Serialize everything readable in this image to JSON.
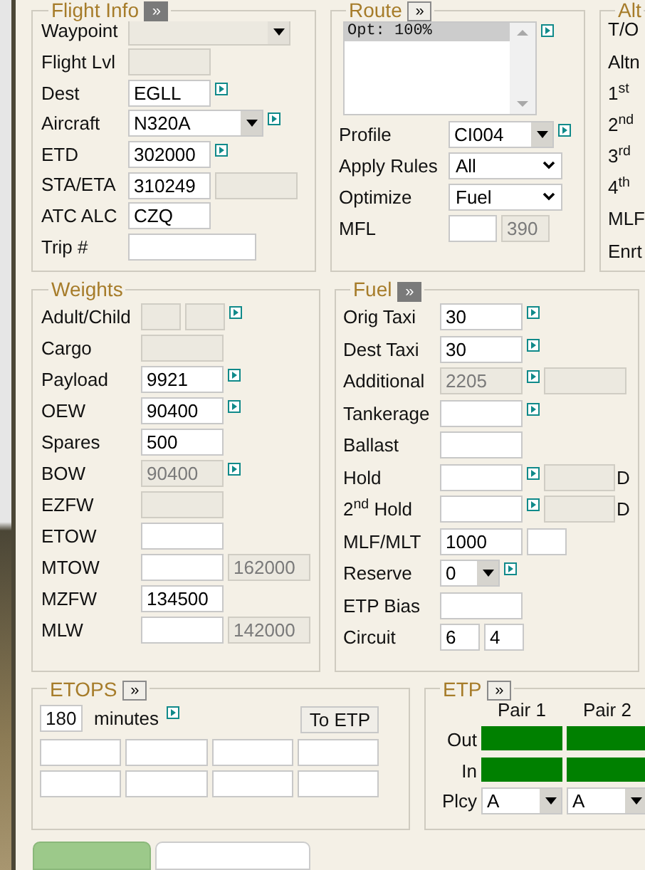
{
  "flight_info": {
    "title": "Flight Info",
    "expand": {
      "label": "»",
      "active": true
    },
    "rows": [
      {
        "label": "Waypoint",
        "controls": [
          {
            "kind": "dropdown-wide",
            "disabled": true
          }
        ]
      },
      {
        "label": "Flight Lvl",
        "controls": [
          {
            "kind": "input",
            "disabled": true
          }
        ]
      },
      {
        "label": "Dest",
        "controls": [
          {
            "kind": "input",
            "value": "EGLL",
            "disabled": false
          },
          {
            "kind": "link"
          }
        ]
      },
      {
        "label": "Aircraft",
        "controls": [
          {
            "kind": "dropdown",
            "value": "N320A",
            "disabled": false
          },
          {
            "kind": "link"
          }
        ]
      },
      {
        "label": "ETD",
        "controls": [
          {
            "kind": "input",
            "value": "302000",
            "disabled": false
          },
          {
            "kind": "link"
          }
        ]
      },
      {
        "label": "STA/ETA",
        "controls": [
          {
            "kind": "input",
            "value": "310249",
            "disabled": false
          },
          {
            "kind": "input",
            "disabled": true
          }
        ]
      },
      {
        "label": "ATC ALC",
        "controls": [
          {
            "kind": "input",
            "value": "CZQ",
            "disabled": false
          }
        ]
      },
      {
        "label": "Trip #",
        "controls": [
          {
            "kind": "input-wide",
            "disabled": false
          }
        ]
      }
    ]
  },
  "route": {
    "title": "Route",
    "expand": {
      "label": "»",
      "active": false
    },
    "lines": [
      {
        "text": "Opt: 100%",
        "selected": true
      }
    ],
    "rows": [
      {
        "label": "Profile",
        "controls": [
          {
            "kind": "dropdown-medium",
            "value": "CI004",
            "disabled": false
          },
          {
            "kind": "link"
          }
        ]
      },
      {
        "label": "Apply Rules",
        "controls": [
          {
            "kind": "select",
            "value": "All",
            "disabled": false
          }
        ]
      },
      {
        "label": "Optimize",
        "controls": [
          {
            "kind": "select",
            "value": "Fuel",
            "disabled": false
          }
        ]
      },
      {
        "label": "MFL",
        "controls": [
          {
            "kind": "input-short",
            "disabled": false
          },
          {
            "kind": "input-short",
            "value": "390",
            "disabled": true
          }
        ]
      }
    ]
  },
  "alternates": {
    "title": "Alt",
    "labels": [
      "T/O",
      "Altn",
      "1$^{st}$",
      "2$^{nd}$",
      "3$^{rd}$",
      "4$^{th}$",
      "MLF",
      "Enrt"
    ]
  },
  "weights": {
    "title": "Weights",
    "rows": [
      {
        "label": "Adult/Child",
        "controls": [
          {
            "kind": "input-narrow",
            "disabled": true
          },
          {
            "kind": "input-narrow",
            "disabled": true
          },
          {
            "kind": "link"
          }
        ]
      },
      {
        "label": "Cargo",
        "controls": [
          {
            "kind": "input",
            "disabled": true
          }
        ]
      },
      {
        "label": "Payload",
        "controls": [
          {
            "kind": "input",
            "value": "9921",
            "disabled": false
          },
          {
            "kind": "link"
          }
        ]
      },
      {
        "label": "OEW",
        "controls": [
          {
            "kind": "input",
            "value": "90400",
            "disabled": false
          },
          {
            "kind": "link"
          }
        ]
      },
      {
        "label": "Spares",
        "controls": [
          {
            "kind": "input",
            "value": "500",
            "disabled": false
          }
        ]
      },
      {
        "label": "BOW",
        "controls": [
          {
            "kind": "input",
            "value": "90400",
            "disabled": true
          },
          {
            "kind": "link"
          }
        ]
      },
      {
        "label": "EZFW",
        "controls": [
          {
            "kind": "input",
            "disabled": true
          }
        ]
      },
      {
        "label": "ETOW",
        "controls": [
          {
            "kind": "input",
            "disabled": false
          }
        ]
      },
      {
        "label": "MTOW",
        "controls": [
          {
            "kind": "input",
            "disabled": false
          },
          {
            "kind": "input",
            "value": "162000",
            "disabled": true
          }
        ]
      },
      {
        "label": "MZFW",
        "controls": [
          {
            "kind": "input",
            "value": "134500",
            "disabled": false
          }
        ]
      },
      {
        "label": "MLW",
        "controls": [
          {
            "kind": "input",
            "disabled": false
          },
          {
            "kind": "input",
            "value": "142000",
            "disabled": true
          }
        ]
      }
    ]
  },
  "fuel": {
    "title": "Fuel",
    "expand": {
      "label": "»",
      "active": true
    },
    "rows": [
      {
        "label": "Orig Taxi",
        "controls": [
          {
            "kind": "input",
            "value": "30",
            "disabled": false
          },
          {
            "kind": "link"
          }
        ]
      },
      {
        "label": "Dest Taxi",
        "controls": [
          {
            "kind": "input",
            "value": "30",
            "disabled": false
          },
          {
            "kind": "link"
          }
        ]
      },
      {
        "label": "Additional",
        "controls": [
          {
            "kind": "input",
            "value": "2205",
            "disabled": true
          },
          {
            "kind": "link"
          },
          {
            "kind": "input",
            "disabled": true
          }
        ]
      },
      {
        "label": "Tankerage",
        "controls": [
          {
            "kind": "input",
            "disabled": false
          },
          {
            "kind": "link"
          }
        ]
      },
      {
        "label": "Ballast",
        "controls": [
          {
            "kind": "input",
            "disabled": false
          }
        ]
      },
      {
        "label": "Hold",
        "controls": [
          {
            "kind": "input",
            "disabled": false
          },
          {
            "kind": "link"
          },
          {
            "kind": "input-medium",
            "disabled": true
          },
          {
            "kind": "suffix",
            "text": "D"
          }
        ]
      },
      {
        "label": "2$^{nd}$ Hold",
        "controls": [
          {
            "kind": "input",
            "disabled": false
          },
          {
            "kind": "link"
          },
          {
            "kind": "input-medium",
            "disabled": true
          },
          {
            "kind": "suffix",
            "text": "D"
          }
        ]
      },
      {
        "label": "MLF/MLT",
        "controls": [
          {
            "kind": "input",
            "value": "1000",
            "disabled": false
          },
          {
            "kind": "input-narrow",
            "disabled": false
          }
        ]
      },
      {
        "label": "Reserve",
        "controls": [
          {
            "kind": "dropdown-narrow",
            "value": "0",
            "disabled": false
          },
          {
            "kind": "link"
          }
        ]
      },
      {
        "label": "ETP Bias",
        "controls": [
          {
            "kind": "input",
            "disabled": false
          }
        ]
      },
      {
        "label": "Circuit",
        "controls": [
          {
            "kind": "input-narrow",
            "value": "6",
            "disabled": false
          },
          {
            "kind": "input-narrow",
            "value": "4",
            "disabled": false
          }
        ]
      }
    ]
  },
  "etops": {
    "title": "ETOPS",
    "expand": {
      "label": "»",
      "active": false
    },
    "minutes": {
      "value": "180",
      "label": "minutes"
    },
    "button": "To ETP",
    "result_fields": [
      {
        "disabled": false
      },
      {
        "disabled": false
      },
      {
        "disabled": false
      },
      {
        "disabled": false
      },
      {
        "disabled": false
      },
      {
        "disabled": false
      },
      {
        "disabled": false
      },
      {
        "disabled": false
      }
    ]
  },
  "etp": {
    "title": "ETP",
    "expand": {
      "label": "»",
      "active": false
    },
    "columns": [
      "Pair 1",
      "Pair 2"
    ],
    "rows": [
      {
        "label": "Out",
        "kind": "status",
        "cells": [
          {
            "color": "#008000"
          },
          {
            "color": "#008000"
          }
        ]
      },
      {
        "label": "In",
        "kind": "status",
        "cells": [
          {
            "color": "#008000"
          },
          {
            "color": "#008000"
          }
        ]
      },
      {
        "label": "Plcy",
        "kind": "dropdown",
        "cells": [
          {
            "value": "A",
            "disabled": false
          },
          {
            "value": "A",
            "disabled": false
          }
        ]
      }
    ]
  },
  "bottom_tabs": [
    {
      "selected": true
    },
    {
      "selected": false
    }
  ]
}
